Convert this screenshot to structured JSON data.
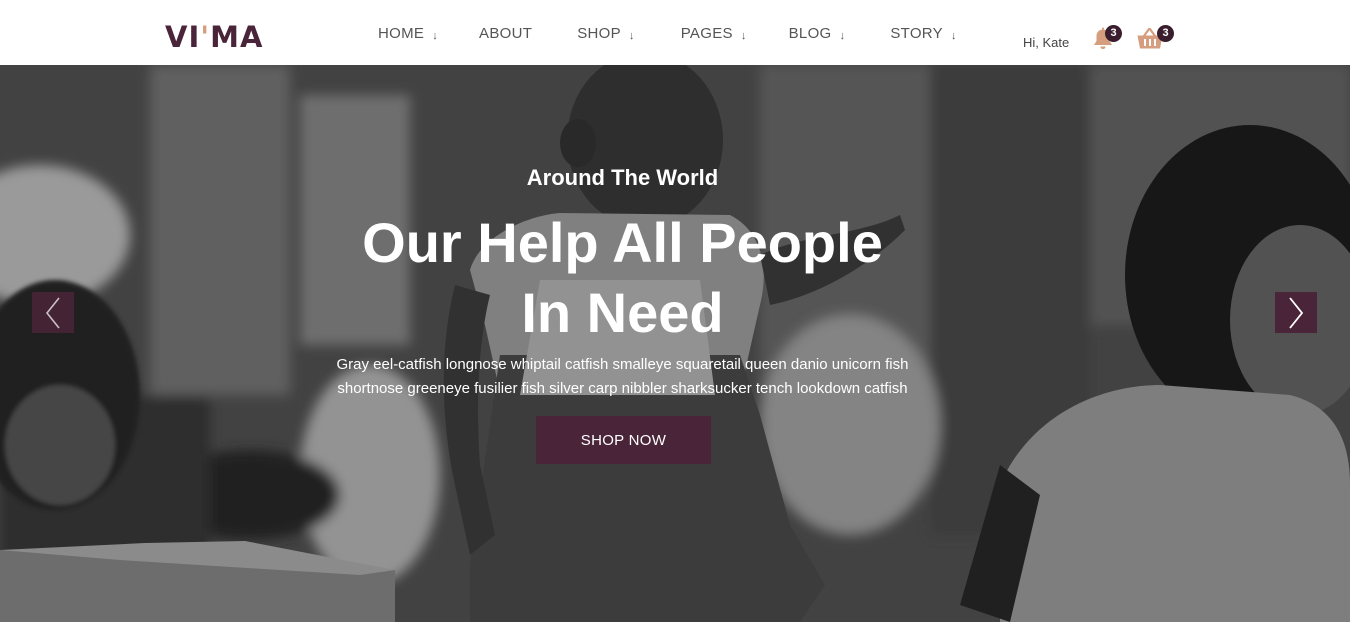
{
  "logo": {
    "part1": "VI",
    "part2": "'",
    "part3": "MA"
  },
  "nav": {
    "home": "HOME",
    "about": "ABOUT",
    "shop": "SHOP",
    "pages": "PAGES",
    "blog": "BLOG",
    "story": "STORY",
    "dropdown_glyph": "↓"
  },
  "user": {
    "greeting": "Hi, Kate",
    "notification_count": "3",
    "cart_count": "3",
    "notification_icon": "bell-icon",
    "cart_icon": "basket-icon"
  },
  "hero": {
    "subtitle": "Around The World",
    "title_line1": "Our Help All People",
    "title_line2": "In Need",
    "desc_line1": "Gray eel-catfish longnose whiptail catfish smalleye squaretail queen danio unicorn fish",
    "desc_line2": "shortnose greeneye fusilier fish silver carp nibbler sharksucker tench lookdown catfish",
    "cta_label": "SHOP NOW",
    "prev_icon": "chevron-left-icon",
    "next_icon": "chevron-right-icon"
  },
  "colors": {
    "brand_dark": "#4a2438",
    "brand_accent": "#d69e7e",
    "badge": "#3a1e2d"
  }
}
